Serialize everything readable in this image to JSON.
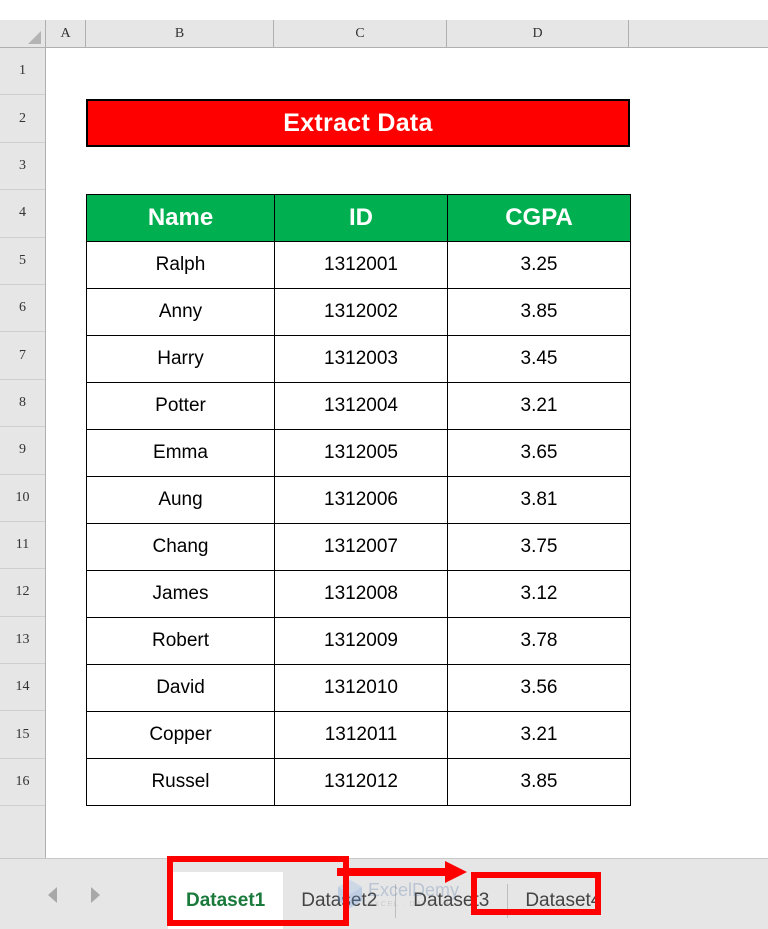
{
  "grid": {
    "column_headers": [
      "A",
      "B",
      "C",
      "D",
      ""
    ],
    "row_headers": [
      "1",
      "2",
      "3",
      "4",
      "5",
      "6",
      "7",
      "8",
      "9",
      "10",
      "11",
      "12",
      "13",
      "14",
      "15",
      "16"
    ],
    "select_all_icon": "select-all-triangle-icon"
  },
  "title_banner": {
    "text": "Extract Data",
    "fill_color": "#FF0000",
    "text_color": "#FFFFFF",
    "border_color": "#000000"
  },
  "table": {
    "header_fill": "#00B050",
    "header_text_color": "#FFFFFF",
    "columns": [
      "Name",
      "ID",
      "CGPA"
    ],
    "rows": [
      [
        "Ralph",
        "1312001",
        "3.25"
      ],
      [
        "Anny",
        "1312002",
        "3.85"
      ],
      [
        "Harry",
        "1312003",
        "3.45"
      ],
      [
        "Potter",
        "1312004",
        "3.21"
      ],
      [
        "Emma",
        "1312005",
        "3.65"
      ],
      [
        "Aung",
        "1312006",
        "3.81"
      ],
      [
        "Chang",
        "1312007",
        "3.75"
      ],
      [
        "James",
        "1312008",
        "3.12"
      ],
      [
        "Robert",
        "1312009",
        "3.78"
      ],
      [
        "David",
        "1312010",
        "3.56"
      ],
      [
        "Copper",
        "1312011",
        "3.21"
      ],
      [
        "Russel",
        "1312012",
        "3.85"
      ]
    ]
  },
  "sheet_tabs": {
    "prev_icon": "previous-sheet-arrow-icon",
    "next_icon": "next-sheet-arrow-icon",
    "items": [
      {
        "label": "Dataset1",
        "active": true
      },
      {
        "label": "Dataset2",
        "active": false
      },
      {
        "label": "Dataset3",
        "active": false
      },
      {
        "label": "Dataset4",
        "active": false
      }
    ],
    "active_color": "#1A7A3C"
  },
  "watermark": {
    "name": "ExcelDemy",
    "tagline": "EXCEL · DATA · BI",
    "logo_icon": "hexagon-logo-icon"
  },
  "annotations": {
    "color": "#FF0000",
    "highlight_1": "Dataset1",
    "highlight_2": "Dataset3",
    "arrow_icon": "right-arrow-icon"
  }
}
